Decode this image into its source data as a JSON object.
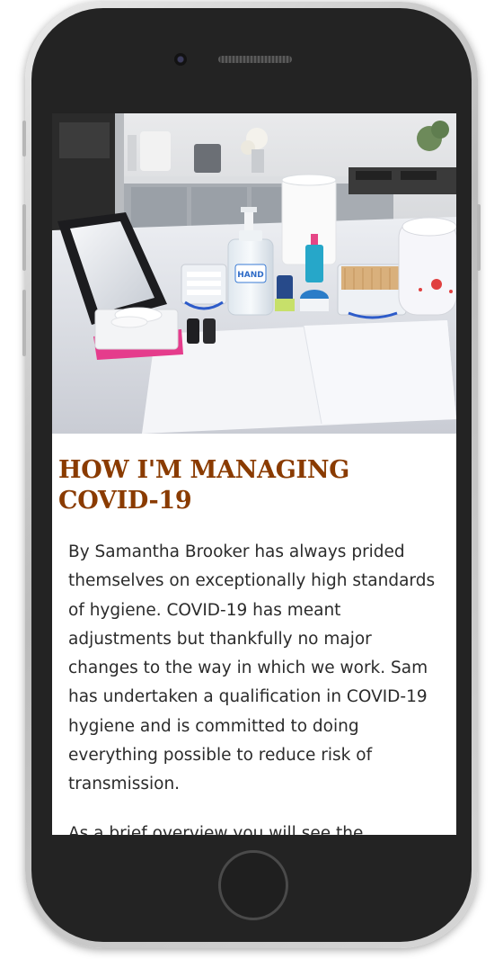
{
  "article": {
    "title": "HOW I'M MANAGING COVID-19",
    "paragraphs": [
      "By Samantha Brooker has always prided themselves on exceptionally high standards of hygiene. COVID-19 has meant adjustments but thankfully no major changes to the way in which we work. Sam has undertaken a qualification in COVID-19 hygiene and is committed to doing everything possible to reduce risk of transmission.",
      "As a brief overview you will see the"
    ]
  },
  "hero_image": {
    "sanitiser_label": "HAND"
  },
  "colors": {
    "title": "#8a3b00",
    "body_text": "#2b2b2b",
    "device_body": "#232323"
  }
}
